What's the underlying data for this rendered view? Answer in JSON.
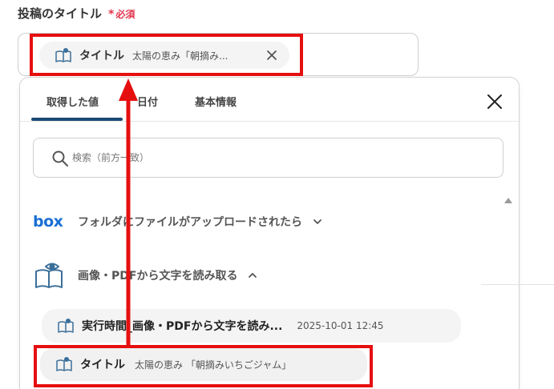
{
  "field": {
    "label": "投稿のタイトル",
    "required_mark": "*",
    "required_text": "必須",
    "chip": {
      "name": "タイトル",
      "value": "太陽の恵み「朝摘み..."
    }
  },
  "panel": {
    "tabs": [
      {
        "label": "取得した値",
        "active": true
      },
      {
        "label": "日付",
        "active": false
      },
      {
        "label": "基本情報",
        "active": false
      }
    ],
    "search": {
      "placeholder": "検索（前方一致）",
      "value": ""
    },
    "groups": [
      {
        "logo": "box",
        "label": "フォルダにファイルがアップロードされたら",
        "expanded": false
      },
      {
        "label": "画像・PDFから文字を読み取る",
        "expanded": true
      }
    ],
    "items": [
      {
        "name": "実行時間_画像・PDFから文字を読み...",
        "value": "2025-10-01 12:45"
      },
      {
        "name": "タイトル",
        "value": "太陽の恵み 「朝摘みいちごジャム」"
      }
    ]
  },
  "colors": {
    "required": "#e2354d",
    "tab_underline": "#1b4b76",
    "box_brand": "#1a6fd5",
    "annotation": "#e60f0f"
  },
  "icons": {
    "chip": "open-book-eye-icon",
    "close": "close-icon",
    "search": "search-icon",
    "expand": "chevron-down-icon",
    "collapse": "chevron-up-icon",
    "ocr": "ocr-book-eye-icon"
  }
}
